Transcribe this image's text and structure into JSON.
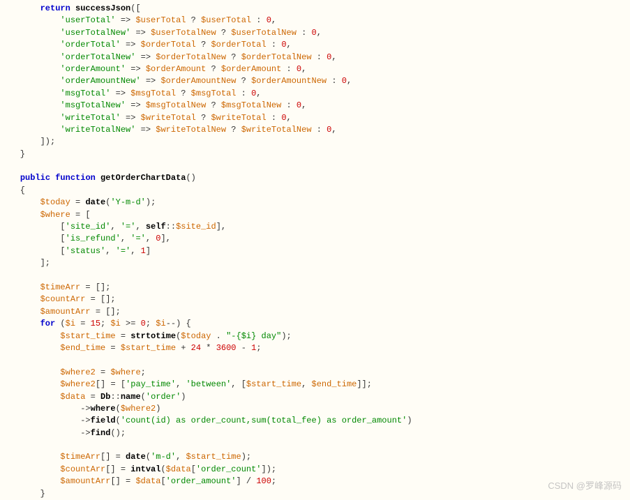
{
  "code": {
    "returnCall": "return",
    "successFn": "successJson",
    "arrayItems": [
      {
        "key": "'userTotal'",
        "var": "$userTotal",
        "fallback": "0"
      },
      {
        "key": "'userTotalNew'",
        "var": "$userTotalNew",
        "fallback": "0"
      },
      {
        "key": "'orderTotal'",
        "var": "$orderTotal",
        "fallback": "0"
      },
      {
        "key": "'orderTotalNew'",
        "var": "$orderTotalNew",
        "fallback": "0"
      },
      {
        "key": "'orderAmount'",
        "var": "$orderAmount",
        "fallback": "0"
      },
      {
        "key": "'orderAmountNew'",
        "var": "$orderAmountNew",
        "fallback": "0"
      },
      {
        "key": "'msgTotal'",
        "var": "$msgTotal",
        "fallback": "0"
      },
      {
        "key": "'msgTotalNew'",
        "var": "$msgTotalNew",
        "fallback": "0"
      },
      {
        "key": "'writeTotal'",
        "var": "$writeTotal",
        "fallback": "0"
      },
      {
        "key": "'writeTotalNew'",
        "var": "$writeTotalNew",
        "fallback": "0"
      }
    ],
    "func": {
      "visibility": "public",
      "keyword": "function",
      "name": "getOrderChartData"
    },
    "body": {
      "todayVar": "$today",
      "dateFn": "date",
      "dateArg": "'Y-m-d'",
      "whereVar": "$where",
      "whereRows": [
        {
          "c0": "'site_id'",
          "c1": "'='",
          "c2type": "self",
          "c2": "self::$site_id"
        },
        {
          "c0": "'is_refund'",
          "c1": "'='",
          "c2type": "num",
          "c2": "0"
        },
        {
          "c0": "'status'",
          "c1": "'='",
          "c2type": "num",
          "c2": "1"
        }
      ],
      "timeArr": "$timeArr",
      "countArr": "$countArr",
      "amountArr": "$amountArr",
      "forKw": "for",
      "iVar": "$i",
      "iStart": "15",
      "iEnd": "0",
      "startTime": "$start_time",
      "strtotime": "strtotime",
      "dayStr": "\"-{$i} day\"",
      "endTime": "$end_time",
      "n24": "24",
      "n3600": "3600",
      "n1": "1",
      "where2": "$where2",
      "betweenRow": {
        "c0": "'pay_time'",
        "c1": "'between'"
      },
      "dataVar": "$data",
      "dbName": "Db::name",
      "orderStr": "'order'",
      "whereM": "where",
      "fieldM": "field",
      "fieldArg": "'count(id) as order_count,sum(total_fee) as order_amount'",
      "findM": "find",
      "mdStr": "'m-d'",
      "intvalFn": "intval",
      "orderCountKey": "'order_count'",
      "orderAmountKey": "'order_amount'",
      "n100": "100"
    }
  },
  "watermark": "CSDN @罗峰源码"
}
